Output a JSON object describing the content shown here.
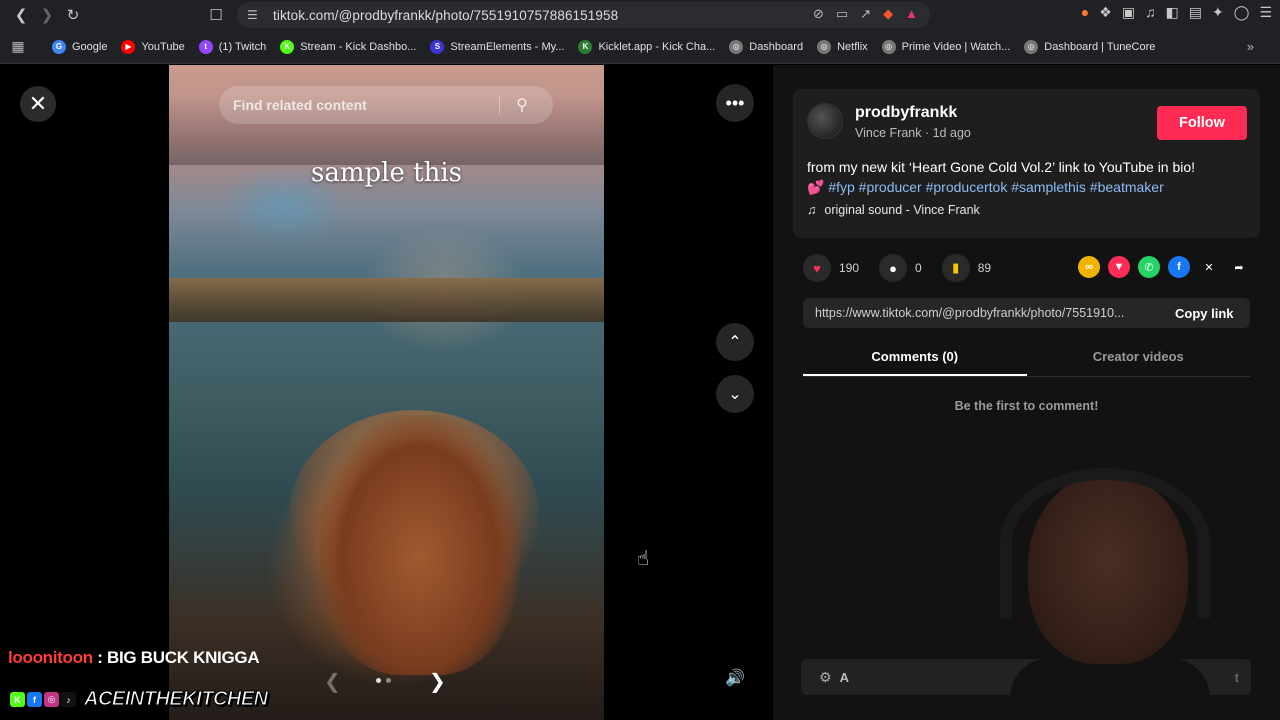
{
  "browser": {
    "url": "tiktok.com/@prodbyfrankk/photo/7551910757886151958",
    "bookmarks": [
      {
        "label": "Google",
        "color": "#4285f4",
        "glyph": "G"
      },
      {
        "label": "YouTube",
        "color": "#ff0000",
        "glyph": "▶"
      },
      {
        "label": "(1) Twitch",
        "color": "#9146ff",
        "glyph": "t"
      },
      {
        "label": "Stream - Kick Dashbo...",
        "color": "#53fc18",
        "glyph": "K"
      },
      {
        "label": "StreamElements - My...",
        "color": "#3c34d6",
        "glyph": "S"
      },
      {
        "label": "Kicklet.app - Kick Cha...",
        "color": "#2e7d32",
        "glyph": "K"
      },
      {
        "label": "Dashboard",
        "color": "#777777",
        "glyph": "◎"
      },
      {
        "label": "Netflix",
        "color": "#777777",
        "glyph": "◎"
      },
      {
        "label": "Prime Video | Watch...",
        "color": "#777777",
        "glyph": "◎"
      },
      {
        "label": "Dashboard | TuneCore",
        "color": "#777777",
        "glyph": "◎"
      }
    ]
  },
  "viewer": {
    "search_placeholder": "Find related content",
    "caption": "sample this",
    "accent_search": "#ffffff"
  },
  "post": {
    "username": "prodbyfrankk",
    "display_name": "Vince Frank",
    "separator": "·",
    "posted": "1d ago",
    "follow_label": "Follow",
    "follow_color": "#fe2c55",
    "description": "from my new kit ‘Heart Gone Cold Vol.2’ link to YouTube in bio!",
    "emoji": "💕",
    "hashtags": "#fyp #producer #producertok #samplethis #beatmaker",
    "sound": "original sound - Vince Frank",
    "likes": "190",
    "comments": "0",
    "saves": "89",
    "link": "https://www.tiktok.com/@prodbyfrankk/photo/7551910...",
    "copy_label": "Copy link",
    "tab_comments": "Comments (0)",
    "tab_creator": "Creator videos",
    "empty_comments": "Be the first to comment!",
    "comment_bar_prefix": "A",
    "comment_bar_suffix": "t"
  },
  "stream": {
    "chat_user": "looonitoon",
    "chat_separator": " : ",
    "chat_text": "BIG BUCK KNIGGA",
    "brand": "ACEINTHEKITCHEN",
    "brand_icons": [
      {
        "glyph": "K",
        "color": "#53fc18"
      },
      {
        "glyph": "f",
        "color": "#1877f2"
      },
      {
        "glyph": "◎",
        "color": "#c13584"
      },
      {
        "glyph": "♪",
        "color": "#111111"
      }
    ]
  }
}
